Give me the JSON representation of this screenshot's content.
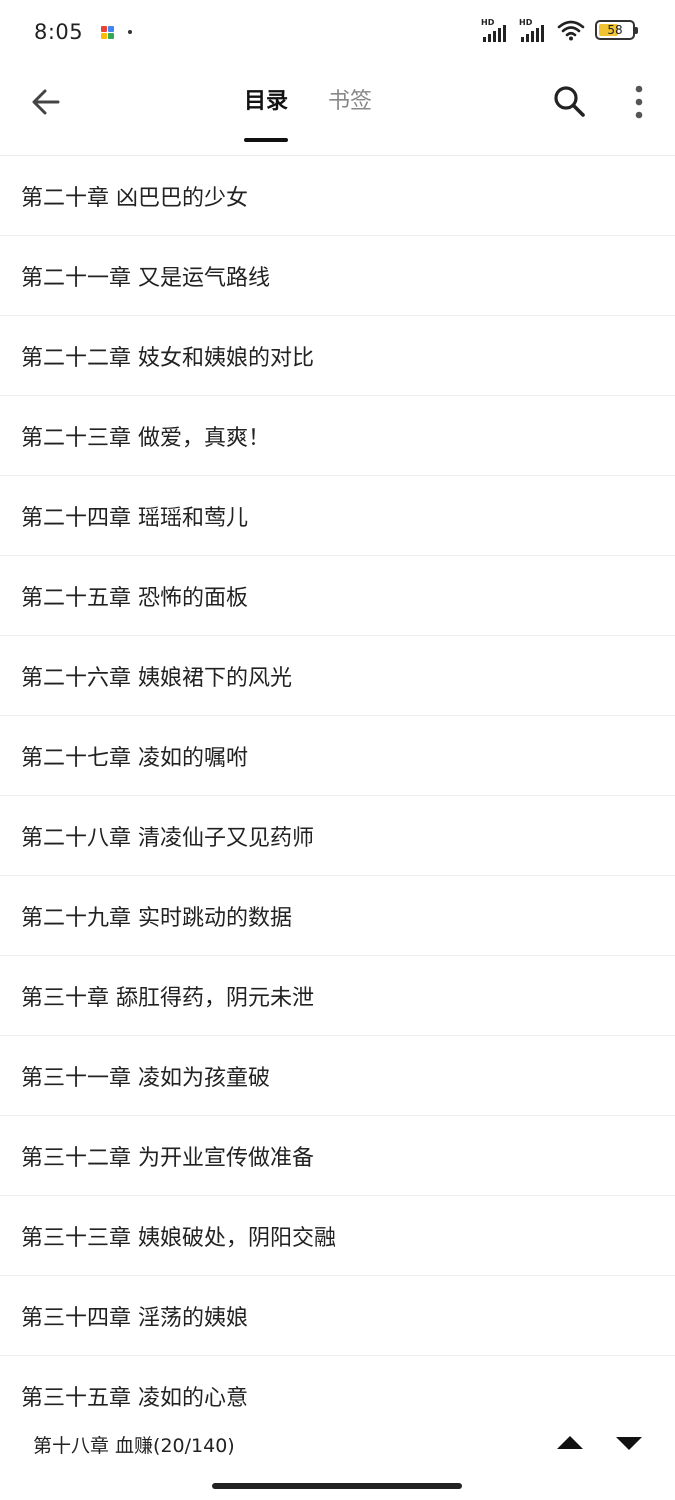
{
  "status_bar": {
    "time": "8:05",
    "signal1_label": "HD",
    "signal2_label": "HD",
    "battery": "58",
    "battery_level": 0.58
  },
  "header": {
    "tabs": [
      {
        "label": "目录",
        "active": true
      },
      {
        "label": "书签",
        "active": false
      }
    ]
  },
  "chapters": [
    "第二十章 凶巴巴的少女",
    "第二十一章 又是运气路线",
    "第二十二章 妓女和姨娘的对比",
    "第二十三章 做爱，真爽！",
    "第二十四章 瑶瑶和莺儿",
    "第二十五章 恐怖的面板",
    "第二十六章 姨娘裙下的风光",
    "第二十七章 凌如的嘱咐",
    "第二十八章 清凌仙子又见药师",
    "第二十九章 实时跳动的数据",
    "第三十章 舔肛得药，阴元未泄",
    "第三十一章 凌如为孩童破",
    "第三十二章 为开业宣传做准备",
    "第三十三章 姨娘破处，阴阳交融",
    "第三十四章 淫荡的姨娘",
    "第三十五章 凌如的心意"
  ],
  "bottom_bar": {
    "current_chapter": "第十八章 血赚(20/140)"
  },
  "icons": {
    "back": "arrow-left-icon",
    "search": "search-icon",
    "more": "more-vertical-icon",
    "up": "triangle-up-icon",
    "down": "triangle-down-icon"
  }
}
